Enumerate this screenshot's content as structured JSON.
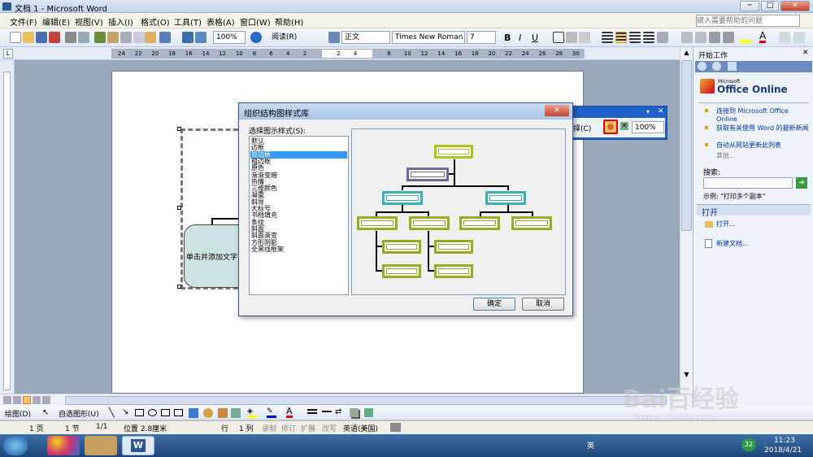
{
  "window": {
    "title": "文档 1 - Microsoft Word",
    "min": "─",
    "max": "□",
    "close": "✕"
  },
  "menu": {
    "items": [
      "文件(F)",
      "编辑(E)",
      "视图(V)",
      "插入(I)",
      "格式(O)",
      "工具(T)",
      "表格(A)",
      "窗口(W)",
      "帮助(H)"
    ],
    "help_placeholder": "键入需要帮助的问题"
  },
  "toolbar": {
    "zoom": "100%",
    "read_label": "阅读(R)",
    "style": "正文",
    "font": "Times New Roman",
    "size": "7"
  },
  "ruler": {
    "ticks": [
      "24",
      "22",
      "20",
      "18",
      "16",
      "14",
      "12",
      "10",
      "8",
      "6",
      "4",
      "2",
      "",
      "2",
      "4",
      "",
      "8",
      "10",
      "12",
      "14",
      "16",
      "18",
      "20",
      "22",
      "24",
      "26",
      "28",
      "30"
    ]
  },
  "document": {
    "shape_text": "单击并添加文字"
  },
  "org_toolbar": {
    "label": "择(C)",
    "zoom": "100%"
  },
  "dialog": {
    "title": "组织结构图样式库",
    "close": "✕",
    "list_label": "选择图示样式(S):",
    "styles": [
      "默认",
      "边框",
      "双边框",
      "粗边框",
      "原色",
      "渐渐变暗",
      "热情",
      "三维颜色",
      "凝重",
      "斜导",
      "大标号",
      "书档填充",
      "条纹",
      "斜面",
      "斜面渐变",
      "方形阴影",
      "全黑线框架"
    ],
    "selected": "双边框",
    "ok": "确定",
    "cancel": "取消"
  },
  "taskpane": {
    "title": "开始工作",
    "logo": "Office Online",
    "logo_small": "Microsoft",
    "links": [
      "连接到 Microsoft Office Online",
      "获取有关使用 Word 的最新新闻",
      "自动从网站更新此列表"
    ],
    "more": "其他...",
    "search_label": "搜索:",
    "example": "示例: \"打印多个副本\"",
    "open_header": "打开",
    "open_link": "打开...",
    "new_doc": "新建文档..."
  },
  "drawbar": {
    "draw": "绘图(D)",
    "autoshape": "自选图形(U)"
  },
  "status": {
    "page": "1 页",
    "section": "1 节",
    "pages": "1/1",
    "position": "位置 2.8厘米",
    "line": "行",
    "col": "1 列",
    "rec": "录制",
    "trk": "修订",
    "ext": "扩展",
    "ovr": "改写",
    "lang": "英语(美国)"
  },
  "taskbar": {
    "time": "11:23",
    "date": "2018/4/21",
    "lang": "英",
    "badge": "32"
  },
  "watermark": {
    "brand": "Bai百经验",
    "url": "jingyan.baidu.com"
  }
}
